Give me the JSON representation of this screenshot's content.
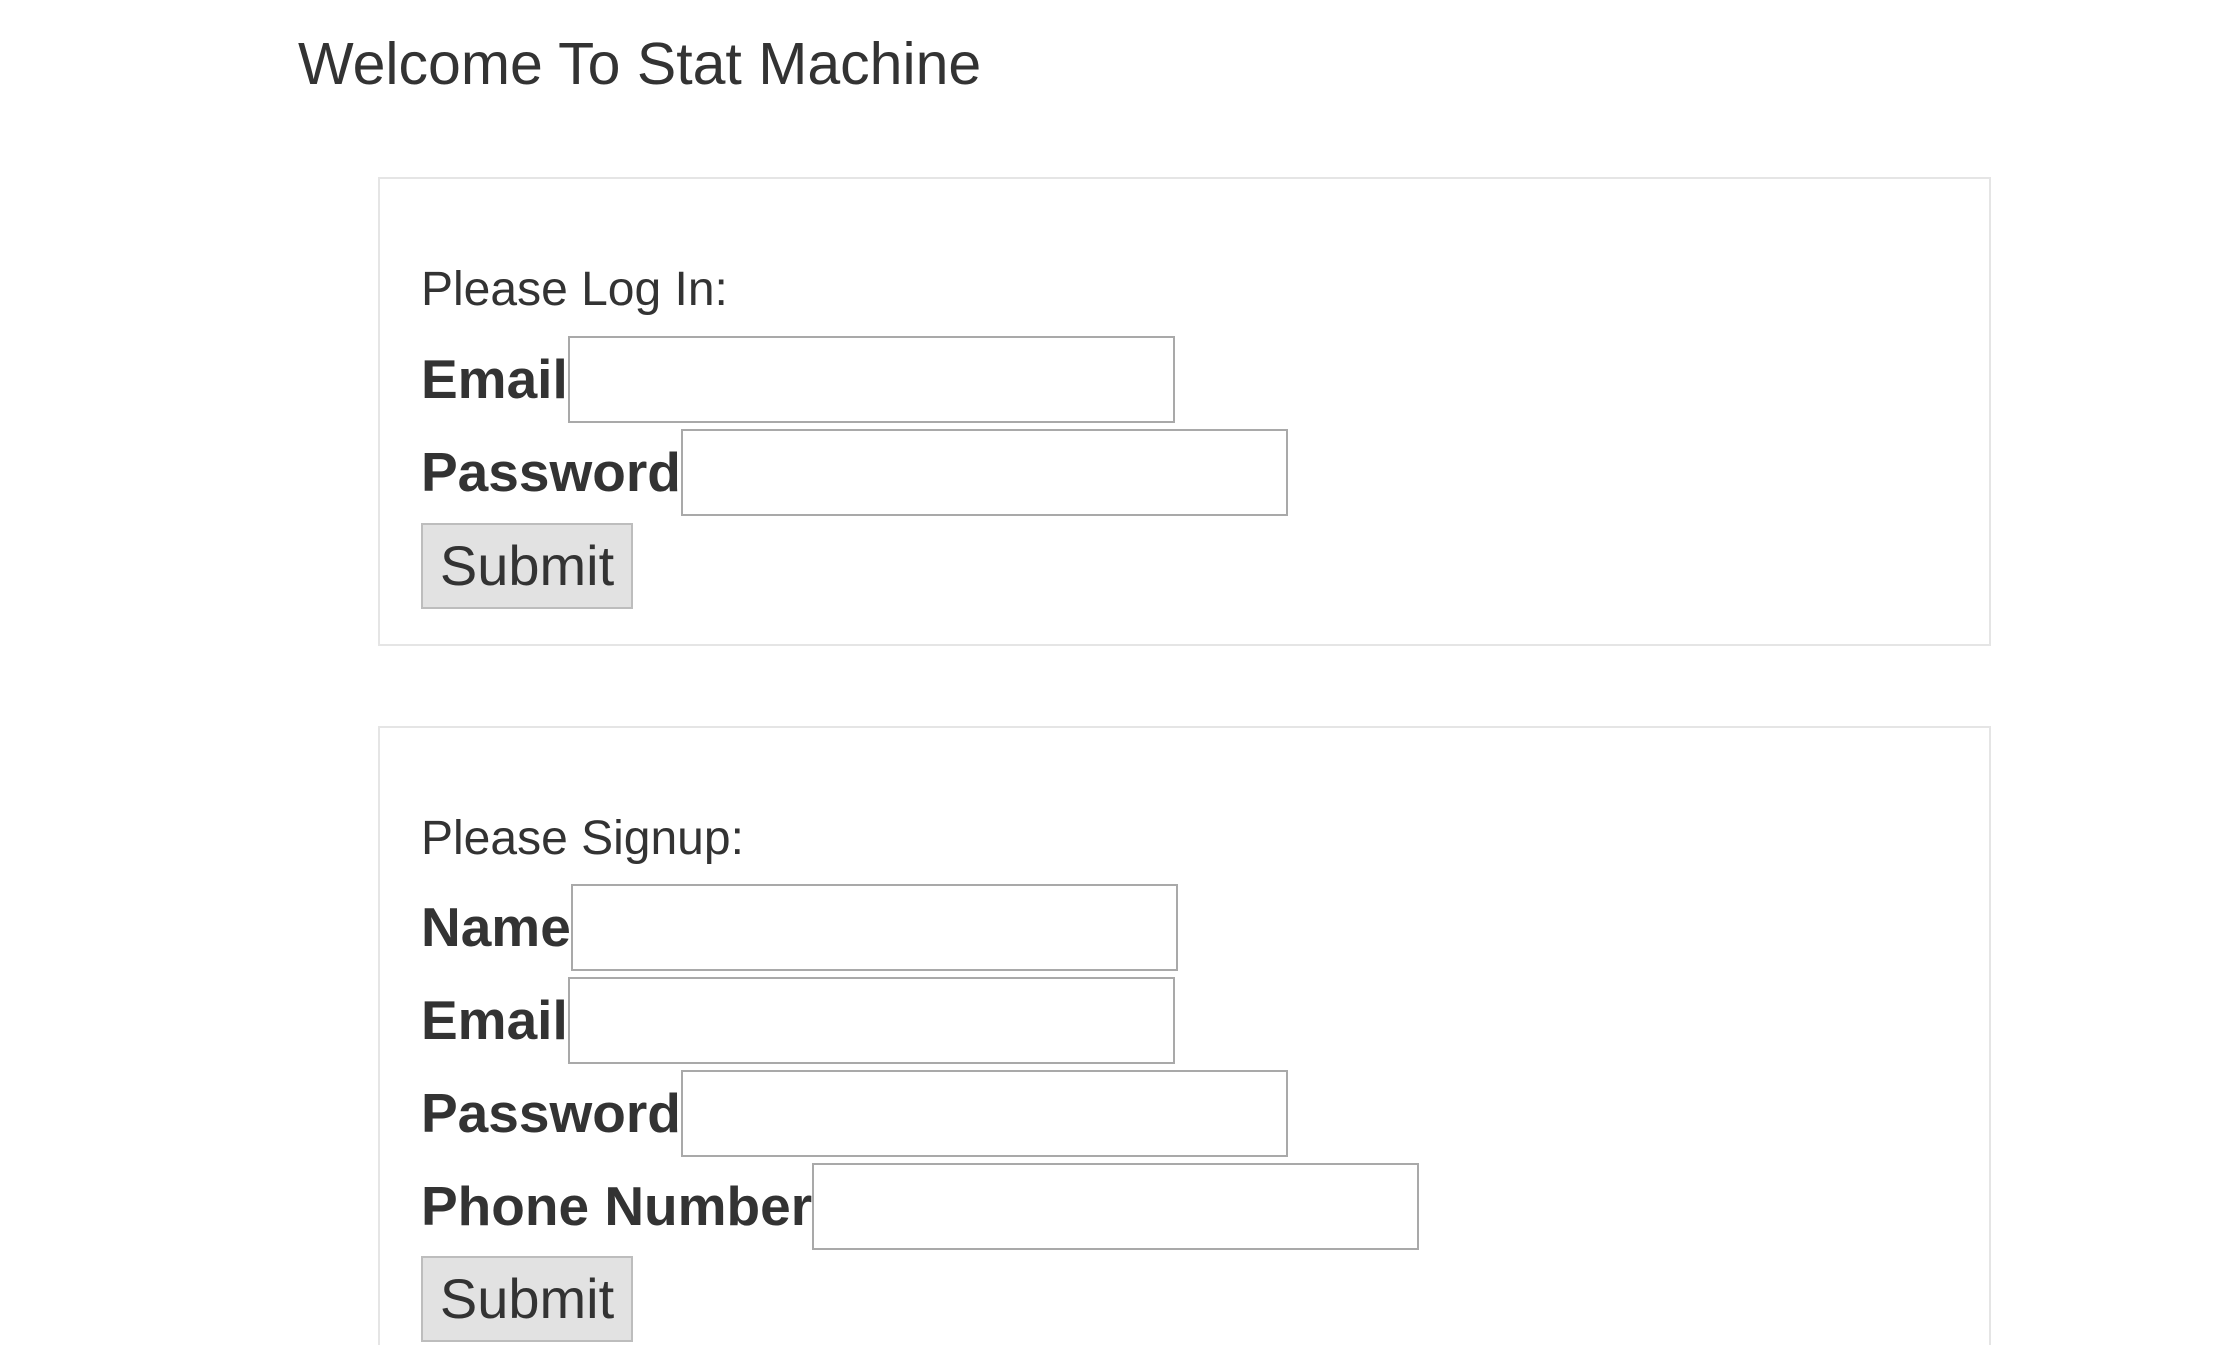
{
  "page": {
    "title": "Welcome To Stat Machine"
  },
  "login": {
    "heading": "Please Log In:",
    "email_label": "Email",
    "email_value": "",
    "password_label": "Password",
    "password_value": "",
    "submit_label": "Submit"
  },
  "signup": {
    "heading": "Please Signup:",
    "name_label": "Name",
    "name_value": "",
    "email_label": "Email",
    "email_value": "",
    "password_label": "Password",
    "password_value": "",
    "phone_label": "Phone Number",
    "phone_value": "",
    "submit_label": "Submit"
  },
  "colors": {
    "text": "#333333",
    "panel_border": "#e5e5e5",
    "input_border": "#a9a9a9",
    "button_background": "#e2e2e2"
  }
}
